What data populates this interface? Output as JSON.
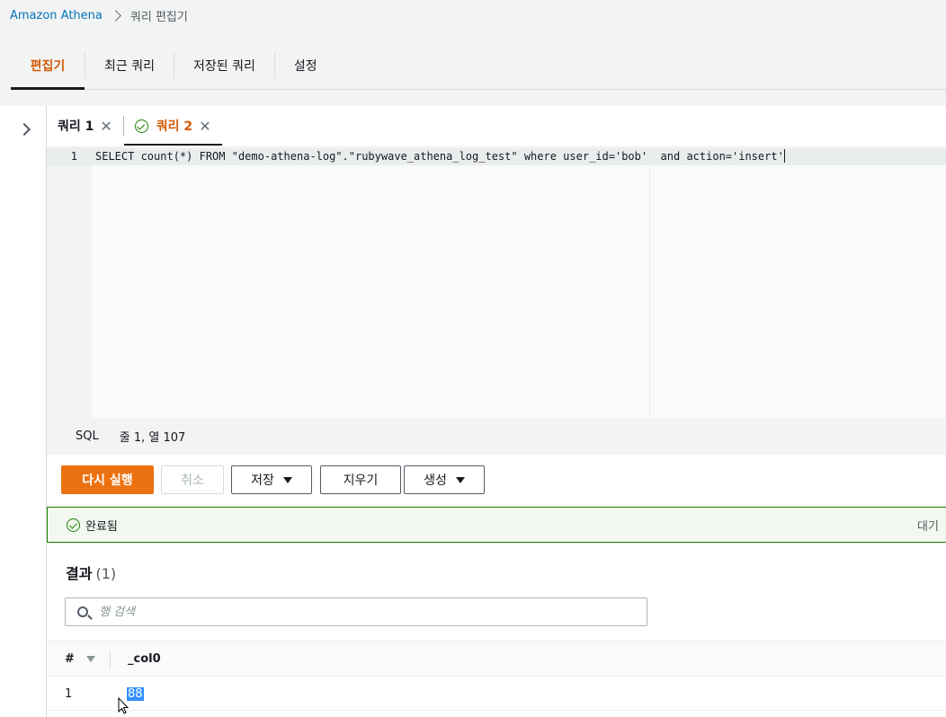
{
  "breadcrumb": {
    "root": "Amazon Athena",
    "current": "쿼리 편집기"
  },
  "top_tabs": [
    {
      "label": "편집기",
      "active": true
    },
    {
      "label": "최근 쿼리",
      "active": false
    },
    {
      "label": "저장된 쿼리",
      "active": false
    },
    {
      "label": "설정",
      "active": false
    }
  ],
  "query_tabs": [
    {
      "label": "쿼리 1",
      "active": false
    },
    {
      "label": "쿼리 2",
      "active": true,
      "status": "completed"
    }
  ],
  "editor": {
    "line_number": "1",
    "query": "SELECT count(*) FROM \"demo-athena-log\".\"rubywave_athena_log_test\" where user_id='bob'  and action='insert'"
  },
  "status_bar": {
    "language": "SQL",
    "position": "줄 1, 열 107"
  },
  "actions": {
    "run_again": "다시 실행",
    "cancel": "취소",
    "save": "저장",
    "clear": "지우기",
    "create": "생성"
  },
  "execution": {
    "status": "완료됨",
    "queue_label": "대기"
  },
  "results": {
    "title": "결과",
    "count": "(1)",
    "search_placeholder": "행 검색",
    "columns": {
      "index": "#",
      "col0": "_col0"
    },
    "rows": [
      {
        "index": "1",
        "col0": "88"
      }
    ]
  },
  "colors": {
    "accent_orange": "#ec7211",
    "tab_active_text": "#d45b07",
    "success_green": "#1d8102",
    "link_blue": "#0073bb"
  }
}
